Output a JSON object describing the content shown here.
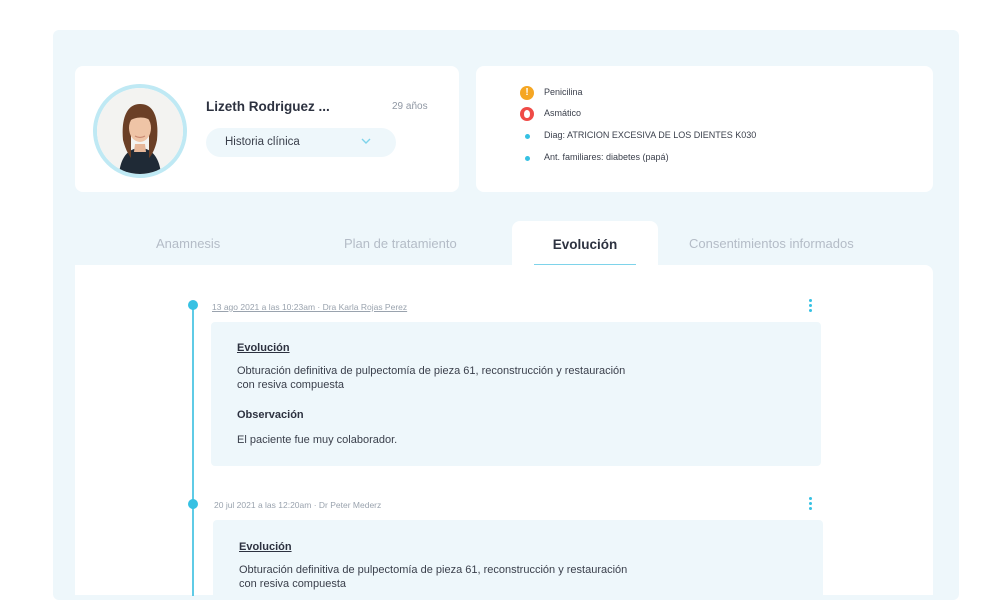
{
  "patient": {
    "name": "Lizeth Rodriguez ...",
    "age": "29 años",
    "record_select": "Historia clínica"
  },
  "alerts": [
    {
      "icon": "warning-icon",
      "text": "Penicilina",
      "color": "#f5a623"
    },
    {
      "icon": "allergy-drop-icon",
      "text": "Asmático",
      "color": "#ef4b47"
    },
    {
      "icon": "bullet-dot-icon",
      "text": "Diag: ATRICION EXCESIVA DE LOS DIENTES K030",
      "color": "#36c1e3"
    },
    {
      "icon": "bullet-dot-icon",
      "text": "Ant. familiares: diabetes (papá)",
      "color": "#36c1e3"
    }
  ],
  "tabs": [
    {
      "label": "Anamnesis",
      "active": false
    },
    {
      "label": "Plan de tratamiento",
      "active": false
    },
    {
      "label": "Evolución",
      "active": true
    },
    {
      "label": "Consentimientos informados",
      "active": false
    }
  ],
  "entries": [
    {
      "meta": "13 ago 2021 a las 10:23am · Dra Karla Rojas Perez",
      "evolution_heading": "Evolución",
      "evolution_text": "Obturación definitiva de pulpectomía de pieza 61, reconstrucción y restauración\ncon resiva compuesta",
      "observation_heading": "Observación",
      "observation_text": "El paciente fue muy colaborador."
    },
    {
      "meta": "20 jul 2021 a las 12:20am · Dr Peter Mederz",
      "evolution_heading": "Evolución",
      "evolution_text": "Obturación definitiva de pulpectomía de pieza 61, reconstrucción y restauración\ncon resiva compuesta"
    }
  ],
  "colors": {
    "accent": "#36c1e3",
    "panel_bg": "#eef7fb",
    "warning": "#f5a623",
    "danger": "#ef4b47"
  }
}
